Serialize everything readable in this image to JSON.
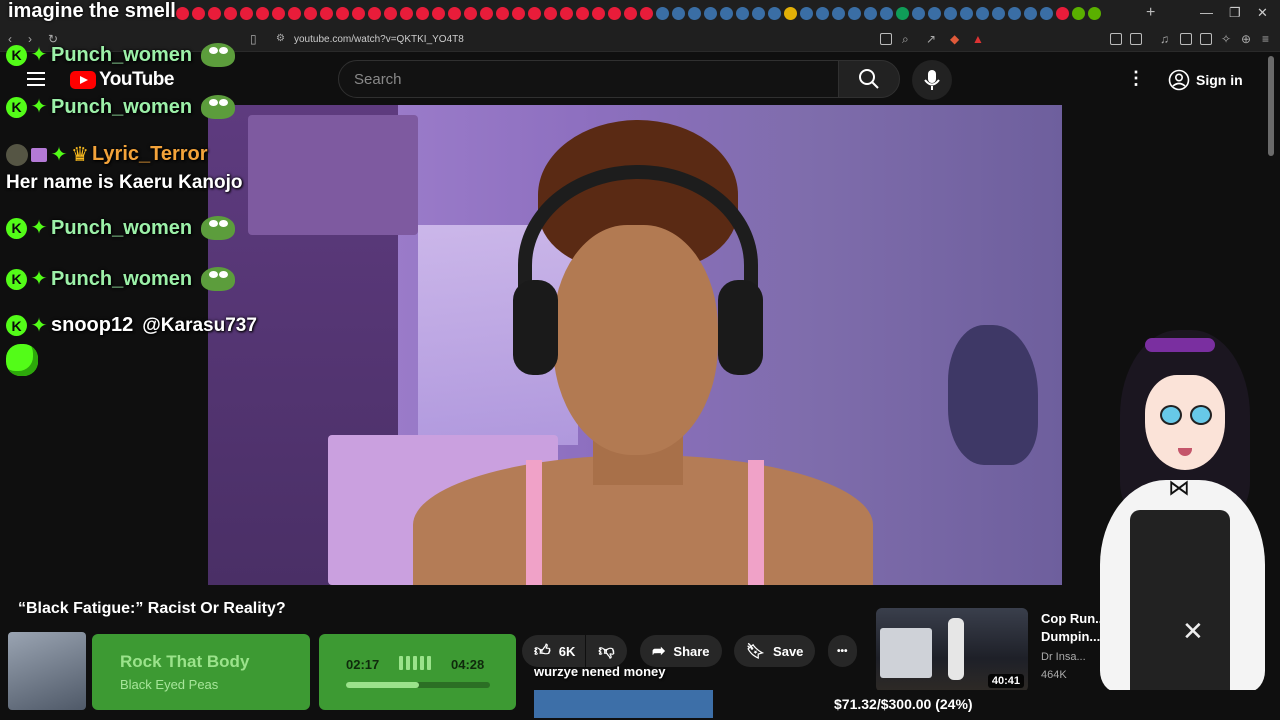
{
  "stream_title": "imagine the smell",
  "browser": {
    "url": "youtube.com/watch?v=QKTKI_YO4T8",
    "tab_colors": [
      "#e81c3a",
      "#e81c3a",
      "#e81c3a",
      "#e81c3a",
      "#e81c3a",
      "#e81c3a",
      "#e81c3a",
      "#e81c3a",
      "#e81c3a",
      "#e81c3a",
      "#e81c3a",
      "#e81c3a",
      "#e81c3a",
      "#e81c3a",
      "#e81c3a",
      "#e81c3a",
      "#e81c3a",
      "#e81c3a",
      "#e81c3a",
      "#e81c3a",
      "#e81c3a",
      "#e81c3a",
      "#e81c3a",
      "#e81c3a",
      "#e81c3a",
      "#e81c3a",
      "#e81c3a",
      "#e81c3a",
      "#e81c3a",
      "#e81c3a",
      "#3a6ea5",
      "#3a6ea5",
      "#3a6ea5",
      "#3a6ea5",
      "#3a6ea5",
      "#3a6ea5",
      "#3a6ea5",
      "#3a6ea5",
      "#e2b007",
      "#3a6ea5",
      "#3a6ea5",
      "#3a6ea5",
      "#3a6ea5",
      "#3a6ea5",
      "#3a6ea5",
      "#0f9d58",
      "#3a6ea5",
      "#3a6ea5",
      "#3a6ea5",
      "#3a6ea5",
      "#3a6ea5",
      "#3a6ea5",
      "#3a6ea5",
      "#3a6ea5",
      "#3a6ea5",
      "#e81c3a",
      "#5ab000",
      "#5ab000"
    ],
    "new_tab": "+",
    "minimize": "—",
    "maximize": "❐",
    "close": "✕"
  },
  "masthead": {
    "logo_text": "YouTube",
    "search_placeholder": "Search",
    "sign_in": "Sign in",
    "more": "⋮"
  },
  "video": {
    "title": "“Black Fatigue:” Racist Or Reality?",
    "likes": "6K",
    "share": "Share",
    "save": "Save",
    "more": "•••"
  },
  "recommended": {
    "title": "Cop Run... Dumpin... dy",
    "channel": "Dr Insa...",
    "views": "464K",
    "duration": "40:41"
  },
  "chat": [
    {
      "user": "Punch_women",
      "color": "#9cf0a8",
      "emote": "pepe"
    },
    {
      "user": "Punch_women",
      "color": "#9cf0a8",
      "emote": "pepe"
    },
    {
      "user": "Lyric_Terror",
      "color": "#f3a33a",
      "emote": ""
    },
    {
      "message": "Her name is Kaeru Kanojo"
    },
    {
      "user": "Punch_women",
      "color": "#9cf0a8",
      "emote": "pepe"
    },
    {
      "user": "Punch_women",
      "color": "#9cf0a8",
      "emote": "pepe"
    },
    {
      "user": "snoop12",
      "color": "#ffffff",
      "message": "@Karasu737"
    }
  ],
  "now_playing": {
    "song": "Rock That Body",
    "artist": "Black Eyed Peas",
    "elapsed": "02:17",
    "total": "04:28",
    "progress": 0.51
  },
  "caption": "wurzye nened money",
  "goal": {
    "text": "$71.32/$300.00 (24%)",
    "progress": 0.24
  },
  "colors": {
    "kick_green": "#53fc18",
    "yt_red": "#ff0000",
    "goal_fill": "#3d6fa8",
    "np_green": "#3d9a33"
  }
}
